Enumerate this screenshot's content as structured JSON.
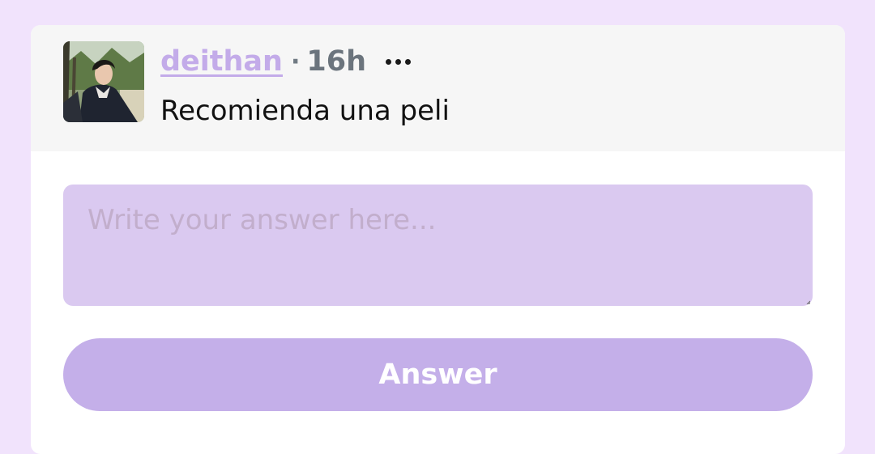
{
  "post": {
    "username": "deithan",
    "separator": "·",
    "time": "16h",
    "question": "Recomienda una peli",
    "more_icon": "more-horizontal-icon",
    "avatar": "profile-photo"
  },
  "answer": {
    "placeholder": "Write your answer here...",
    "button_label": "Answer"
  },
  "colors": {
    "page_bg": "#f1e3fc",
    "header_bg": "#f6f6f6",
    "username": "#c3abe9",
    "input_bg": "#dac9f0",
    "button_bg": "#c4afe9"
  }
}
